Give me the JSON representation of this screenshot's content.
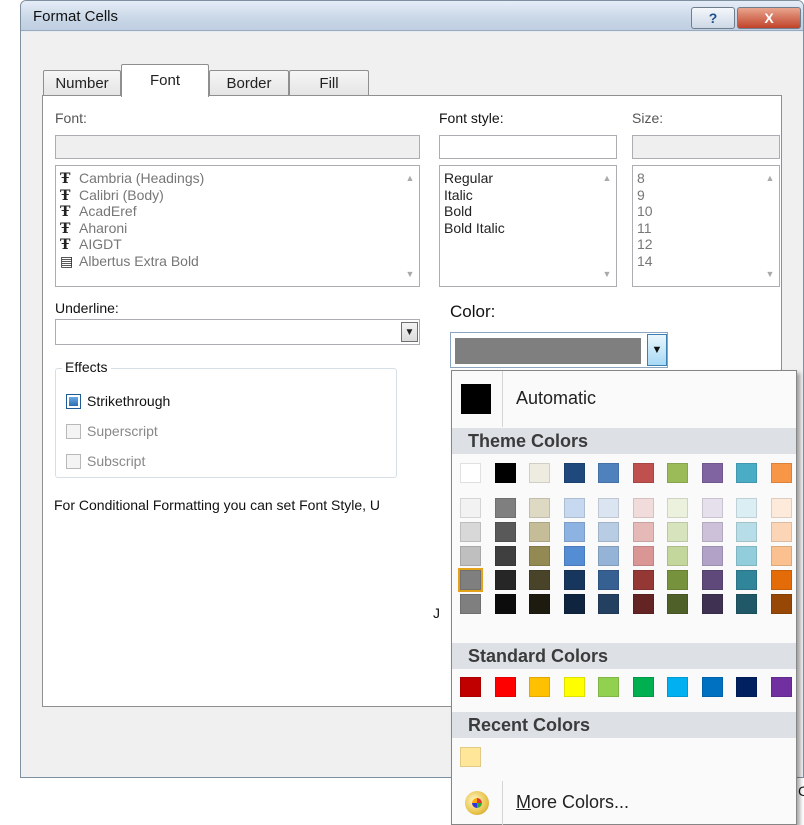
{
  "window": {
    "title": "Format Cells",
    "help_label": "?",
    "close_label": "X"
  },
  "tabs": [
    {
      "label": "Number"
    },
    {
      "label": "Font"
    },
    {
      "label": "Border"
    },
    {
      "label": "Fill"
    }
  ],
  "font": {
    "label": "Font:",
    "value": "",
    "items": [
      "Cambria (Headings)",
      "Calibri (Body)",
      "AcadEref",
      "Aharoni",
      "AIGDT",
      "Albertus Extra Bold"
    ]
  },
  "font_style": {
    "label": "Font style:",
    "value": "",
    "items": [
      "Regular",
      "Italic",
      "Bold",
      "Bold Italic"
    ]
  },
  "size": {
    "label": "Size:",
    "value": "",
    "items": [
      "8",
      "9",
      "10",
      "11",
      "12",
      "14"
    ]
  },
  "underline": {
    "label": "Underline:",
    "value": ""
  },
  "color": {
    "label": "Color:",
    "current": "#7f7f7f"
  },
  "effects": {
    "title": "Effects",
    "items": [
      {
        "label": "Strikethrough",
        "checked": true,
        "enabled": true
      },
      {
        "label": "Superscript",
        "checked": false,
        "enabled": false
      },
      {
        "label": "Subscript",
        "checked": false,
        "enabled": false
      }
    ]
  },
  "description": "For Conditional Formatting you can set Font Style, U",
  "hidden_fragments": [
    "J",
    "C"
  ],
  "palette": {
    "automatic_label": "Automatic",
    "theme_heading": "Theme Colors",
    "theme_columns": [
      [
        "#ffffff",
        "#f2f2f2",
        "#d8d8d8",
        "#bfbfbf",
        "#a5a5a5",
        "#7f7f7f"
      ],
      [
        "#000000",
        "#7f7f7f",
        "#595959",
        "#3f3f3f",
        "#262626",
        "#0c0c0c"
      ],
      [
        "#eeece1",
        "#ddd9c3",
        "#c4bd97",
        "#938953",
        "#494429",
        "#1d1b10"
      ],
      [
        "#1f497d",
        "#c6d9f0",
        "#8db3e2",
        "#548dd4",
        "#17365d",
        "#0f243e"
      ],
      [
        "#4f81bd",
        "#dbe5f1",
        "#b8cce4",
        "#95b3d7",
        "#366092",
        "#244061"
      ],
      [
        "#c0504d",
        "#f2dcdb",
        "#e5b9b7",
        "#d99694",
        "#953734",
        "#632423"
      ],
      [
        "#9bbb59",
        "#ebf1dd",
        "#d7e3bc",
        "#c3d69b",
        "#76923c",
        "#4f6128"
      ],
      [
        "#8064a2",
        "#e5e0ec",
        "#ccc1d9",
        "#b2a2c7",
        "#5f497a",
        "#3f3151"
      ],
      [
        "#4bacc6",
        "#dbeef3",
        "#b7dde8",
        "#92cddc",
        "#31859b",
        "#205867"
      ],
      [
        "#f79646",
        "#fdeada",
        "#fbd5b5",
        "#fac08f",
        "#e36c09",
        "#974806"
      ]
    ],
    "standard_heading": "Standard Colors",
    "standard_colors": [
      "#c00000",
      "#ff0000",
      "#ffc000",
      "#ffff00",
      "#92d050",
      "#00b050",
      "#00b0f0",
      "#0070c0",
      "#002060",
      "#7030a0"
    ],
    "recent_heading": "Recent Colors",
    "recent_colors": [
      "#ffe699"
    ],
    "more_label": "More Colors..."
  }
}
